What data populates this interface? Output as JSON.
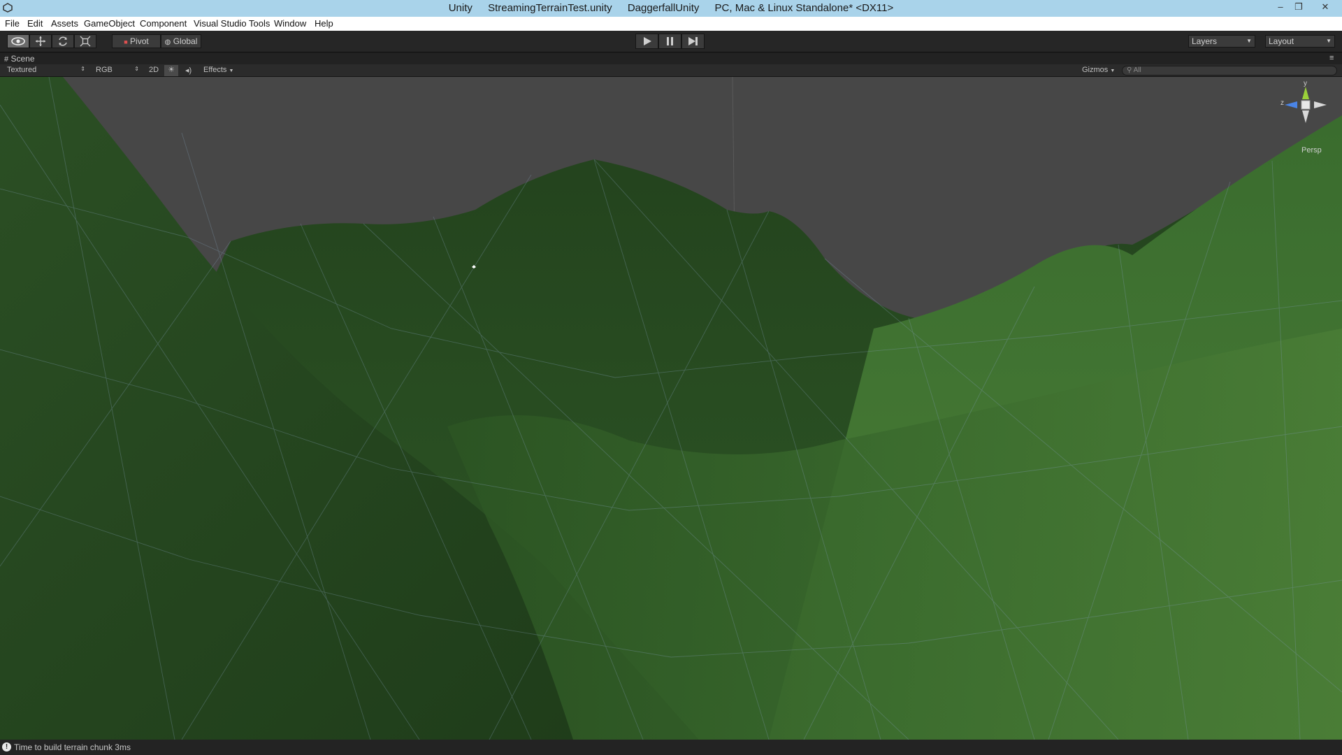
{
  "window": {
    "title_parts": [
      "Unity",
      "StreamingTerrainTest.unity",
      "DaggerfallUnity",
      "PC, Mac & Linux Standalone* <DX11>"
    ],
    "controls": {
      "minimize": "–",
      "restore": "❐",
      "close": "✕"
    }
  },
  "menu": {
    "items": [
      "File",
      "Edit",
      "Assets",
      "GameObject",
      "Component",
      "Visual Studio Tools",
      "Window",
      "Help"
    ]
  },
  "toolbar": {
    "pivot_label": "Pivot",
    "global_label": "Global",
    "layers_label": "Layers",
    "layout_label": "Layout",
    "tools": [
      "hand-icon",
      "move-icon",
      "rotate-icon",
      "scale-icon"
    ],
    "playback": [
      "play-icon",
      "pause-icon",
      "step-icon"
    ]
  },
  "scene_tab": {
    "label": "Scene"
  },
  "scene_toolbar": {
    "shading_mode": "Textured",
    "render_mode": "RGB",
    "mode_2d": "2D",
    "effects_label": "Effects",
    "gizmos_label": "Gizmos",
    "search_placeholder": "All"
  },
  "scene_gizmo": {
    "y_label": "y",
    "z_label": "z",
    "projection_label": "Persp",
    "colors": {
      "y": "#9bd13a",
      "x": "#d9d9d9",
      "z": "#4a84e6"
    }
  },
  "status": {
    "message": "Time to build terrain chunk 3ms"
  },
  "colors": {
    "title_bar": "#a9d3ea",
    "sky": "#474747",
    "terrain_dark": "#1f3a19",
    "terrain_mid": "#2f5a26",
    "terrain_light": "#467a34",
    "wire": "#6b8aa0"
  }
}
